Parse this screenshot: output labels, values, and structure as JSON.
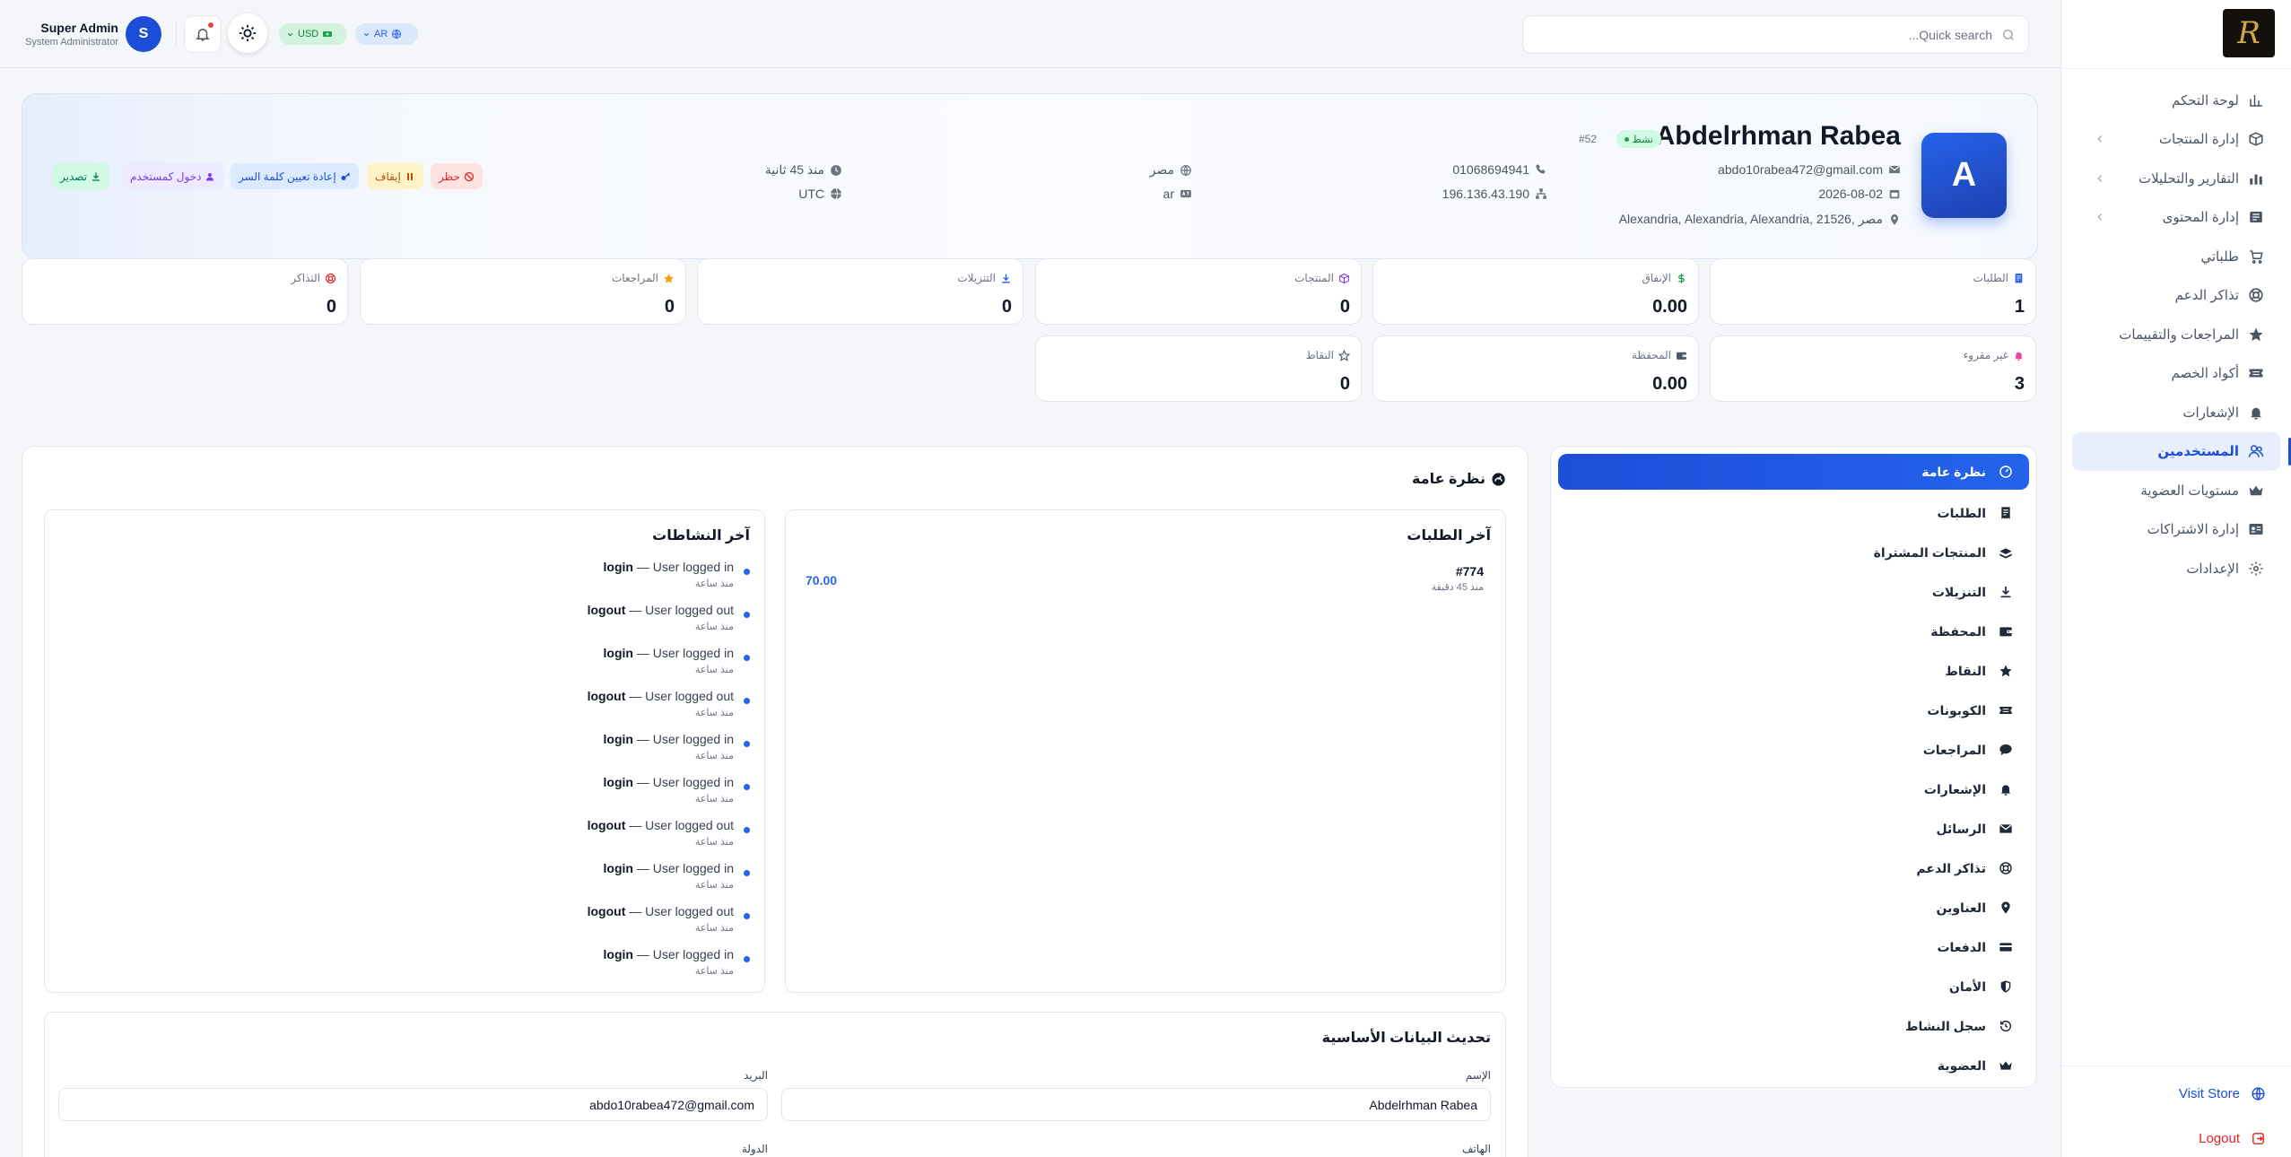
{
  "sidebar": {
    "logo_text": "R",
    "items": [
      {
        "label": "لوحة التحكم",
        "icon": "chart-bar-icon"
      },
      {
        "label": "إدارة المنتجات",
        "icon": "box-icon",
        "has_children": true
      },
      {
        "label": "التقارير والتحليلات",
        "icon": "chart-icon",
        "has_children": true
      },
      {
        "label": "إدارة المحتوى",
        "icon": "newspaper-icon",
        "has_children": true
      },
      {
        "label": "طلباتي",
        "icon": "cart-icon"
      },
      {
        "label": "تذاكر الدعم",
        "icon": "lifebuoy-icon"
      },
      {
        "label": "المراجعات والتقييمات",
        "icon": "star-icon"
      },
      {
        "label": "أكواد الخصم",
        "icon": "ticket-icon"
      },
      {
        "label": "الإشعارات",
        "icon": "bell-icon"
      },
      {
        "label": "المستخدمين",
        "icon": "users-icon",
        "active": true
      },
      {
        "label": "مستويات العضوية",
        "icon": "crown-icon"
      },
      {
        "label": "إدارة الاشتراكات",
        "icon": "id-card-icon"
      },
      {
        "label": "الإعدادات",
        "icon": "gear-icon"
      }
    ],
    "visit_store": "Visit Store",
    "logout": "Logout"
  },
  "topbar": {
    "search_placeholder": "Quick search...",
    "admin_name": "Super Admin",
    "admin_role": "System Administrator",
    "admin_initial": "S",
    "currency": "USD",
    "language": "AR"
  },
  "profile": {
    "initial": "A",
    "name": "Abdelrhman Rabea",
    "status": "نشط",
    "id": "#52",
    "email": "abdo10rabea472@gmail.com",
    "phone": "01068694941",
    "country": "مصر",
    "last_seen": "منذ 45 ثانية",
    "joined": "2026-08-02",
    "ip": "196.136.43.190",
    "language": "ar",
    "timezone": "UTC",
    "address": "Alexandria, Alexandria, Alexandria, 21526, مصر",
    "actions": {
      "ban": "حظر",
      "suspend": "إيقاف",
      "reset_password": "إعادة تعيين كلمة السر",
      "impersonate": "دخول كمستخدم",
      "export": "تصدير"
    }
  },
  "stats": [
    {
      "label": "الطلبات",
      "value": "1",
      "icon": "receipt-icon",
      "color": "#2563eb"
    },
    {
      "label": "الإنفاق",
      "value": "0.00",
      "icon": "dollar-icon",
      "color": "#16a34a"
    },
    {
      "label": "المنتجات",
      "value": "0",
      "icon": "box-icon",
      "color": "#7c3aed"
    },
    {
      "label": "التنزيلات",
      "value": "0",
      "icon": "download-icon",
      "color": "#2563eb"
    },
    {
      "label": "المراجعات",
      "value": "0",
      "icon": "star-icon",
      "color": "#f59e0b"
    },
    {
      "label": "التذاكر",
      "value": "0",
      "icon": "lifebuoy-icon",
      "color": "#dc2626"
    },
    {
      "label": "غير مقروء",
      "value": "3",
      "icon": "bell-icon",
      "color": "#ec4899"
    },
    {
      "label": "المحفظة",
      "value": "0.00",
      "icon": "wallet-icon",
      "color": "#4b5563"
    },
    {
      "label": "النقاط",
      "value": "0",
      "icon": "star-outline-icon",
      "color": "#4b5563"
    }
  ],
  "user_menu": [
    {
      "label": "نظرة عامة",
      "icon": "gauge-icon",
      "active": true
    },
    {
      "label": "الطلبات",
      "icon": "receipt-icon"
    },
    {
      "label": "المنتجات المشتراة",
      "icon": "boxes-icon"
    },
    {
      "label": "التنزيلات",
      "icon": "download-icon"
    },
    {
      "label": "المحفظة",
      "icon": "wallet-icon"
    },
    {
      "label": "النقاط",
      "icon": "star-icon"
    },
    {
      "label": "الكوبونات",
      "icon": "ticket-icon"
    },
    {
      "label": "المراجعات",
      "icon": "comment-icon"
    },
    {
      "label": "الإشعارات",
      "icon": "bell-icon"
    },
    {
      "label": "الرسائل",
      "icon": "envelope-icon"
    },
    {
      "label": "تذاكر الدعم",
      "icon": "lifebuoy-icon"
    },
    {
      "label": "العناوين",
      "icon": "location-pin-icon"
    },
    {
      "label": "الدفعات",
      "icon": "credit-card-icon"
    },
    {
      "label": "الأمان",
      "icon": "shield-icon"
    },
    {
      "label": "سجل النشاط",
      "icon": "history-icon"
    },
    {
      "label": "العضوية",
      "icon": "crown-icon"
    }
  ],
  "overview": {
    "title": "نظرة عامة",
    "orders_title": "آخر الطلبات",
    "order": {
      "number": "#774",
      "time": "منذ 45 دقيقة",
      "amount": "70.00"
    },
    "activities_title": "آخر النشاطات",
    "activities": [
      {
        "type": "login",
        "text": "— User logged in",
        "time": "منذ ساعة"
      },
      {
        "type": "logout",
        "text": "— User logged out",
        "time": "منذ ساعة"
      },
      {
        "type": "login",
        "text": "— User logged in",
        "time": "منذ ساعة"
      },
      {
        "type": "logout",
        "text": "— User logged out",
        "time": "منذ ساعة"
      },
      {
        "type": "login",
        "text": "— User logged in",
        "time": "منذ ساعة"
      },
      {
        "type": "login",
        "text": "— User logged in",
        "time": "منذ ساعة"
      },
      {
        "type": "logout",
        "text": "— User logged out",
        "time": "منذ ساعة"
      },
      {
        "type": "login",
        "text": "— User logged in",
        "time": "منذ ساعة"
      },
      {
        "type": "logout",
        "text": "— User logged out",
        "time": "منذ ساعة"
      },
      {
        "type": "login",
        "text": "— User logged in",
        "time": "منذ ساعة"
      }
    ]
  },
  "basic_form": {
    "title": "تحديث البيانات الأساسية",
    "name_label": "الإسم",
    "name_value": "Abdelrhman Rabea",
    "email_label": "البريد",
    "email_value": "abdo10rabea472@gmail.com",
    "phone_label": "الهاتف",
    "country_label": "الدولة"
  }
}
